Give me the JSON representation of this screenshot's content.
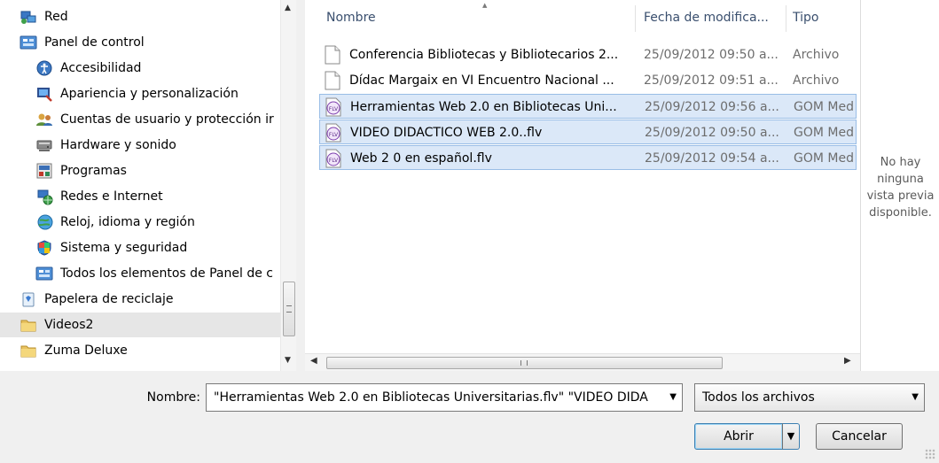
{
  "tree": {
    "items": [
      {
        "label": "Red",
        "icon": "network-icon",
        "indent": 0
      },
      {
        "label": "Panel de control",
        "icon": "control-panel-icon",
        "indent": 0
      },
      {
        "label": "Accesibilidad",
        "icon": "accessibility-icon",
        "indent": 1
      },
      {
        "label": "Apariencia y personalización",
        "icon": "appearance-icon",
        "indent": 1
      },
      {
        "label": "Cuentas de usuario y protección ir",
        "icon": "user-accounts-icon",
        "indent": 1
      },
      {
        "label": "Hardware y sonido",
        "icon": "hardware-sound-icon",
        "indent": 1
      },
      {
        "label": "Programas",
        "icon": "programs-icon",
        "indent": 1
      },
      {
        "label": "Redes e Internet",
        "icon": "network-internet-icon",
        "indent": 1
      },
      {
        "label": "Reloj, idioma y región",
        "icon": "clock-region-icon",
        "indent": 1
      },
      {
        "label": "Sistema y seguridad",
        "icon": "system-security-icon",
        "indent": 1
      },
      {
        "label": "Todos los elementos de Panel de c",
        "icon": "all-control-panel-icon",
        "indent": 1
      },
      {
        "label": "Papelera de reciclaje",
        "icon": "recycle-bin-icon",
        "indent": 0
      },
      {
        "label": "Videos2",
        "icon": "folder-icon",
        "indent": 0,
        "selected": true
      },
      {
        "label": "Zuma Deluxe",
        "icon": "folder-icon",
        "indent": 0
      }
    ]
  },
  "columns": {
    "name": "Nombre",
    "date": "Fecha de modifica...",
    "type": "Tipo"
  },
  "files": [
    {
      "name": "Conferencia Bibliotecas y Bibliotecarios 2...",
      "date": "25/09/2012 09:50 a...",
      "type": "Archivo",
      "icon": "blank-file-icon",
      "selected": false
    },
    {
      "name": "Dídac Margaix en VI Encuentro Nacional ...",
      "date": "25/09/2012 09:51 a...",
      "type": "Archivo",
      "icon": "blank-file-icon",
      "selected": false
    },
    {
      "name": "Herramientas Web 2.0 en Bibliotecas Uni...",
      "date": "25/09/2012 09:56 a...",
      "type": "GOM Med",
      "icon": "flv-file-icon",
      "selected": true
    },
    {
      "name": "VIDEO DIDACTICO WEB 2.0..flv",
      "date": "25/09/2012 09:50 a...",
      "type": "GOM Med",
      "icon": "flv-file-icon",
      "selected": true
    },
    {
      "name": "Web 2 0 en español.flv",
      "date": "25/09/2012 09:54 a...",
      "type": "GOM Med",
      "icon": "flv-file-icon",
      "selected": true
    }
  ],
  "preview": {
    "text_lines": [
      "No hay",
      "ninguna",
      "vista previa",
      "disponible."
    ]
  },
  "footer": {
    "name_label": "Nombre:",
    "name_value": "\"Herramientas Web 2.0 en Bibliotecas Universitarias.flv\" \"VIDEO DIDA",
    "filter_value": "Todos los archivos",
    "open_label": "Abrir",
    "cancel_label": "Cancelar"
  },
  "scroll": {
    "hscroll_grip": "III"
  },
  "colors": {
    "selection_bg": "#dbe8f8",
    "selection_border": "#99bde6",
    "header_text": "#3a4f6e"
  }
}
